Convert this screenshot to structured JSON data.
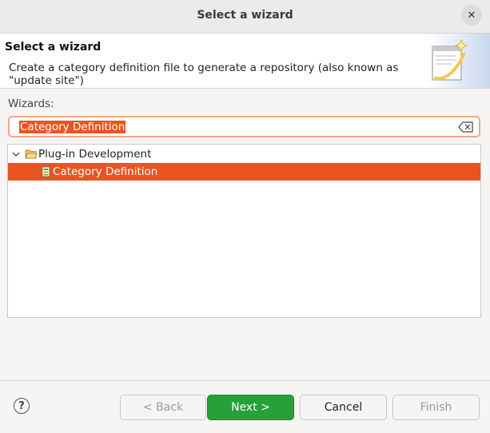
{
  "window": {
    "title": "Select a wizard"
  },
  "header": {
    "title": "Select a wizard",
    "description_line1": "Create a category definition file to generate a repository (also known as",
    "description_line2": "\"update site\")"
  },
  "wizards": {
    "label": "Wizards:",
    "filter_value": "Category Definition",
    "tree": [
      {
        "label": "Plug-in Development",
        "icon": "folder-open-icon",
        "expanded": true,
        "children": [
          {
            "label": "Category Definition",
            "icon": "category-file-icon",
            "selected": true
          }
        ]
      }
    ]
  },
  "buttons": {
    "back": "< Back",
    "next": "Next >",
    "cancel": "Cancel",
    "finish": "Finish",
    "help_glyph": "?"
  },
  "colors": {
    "accent": "#e95420",
    "primary_button": "#26a039"
  }
}
